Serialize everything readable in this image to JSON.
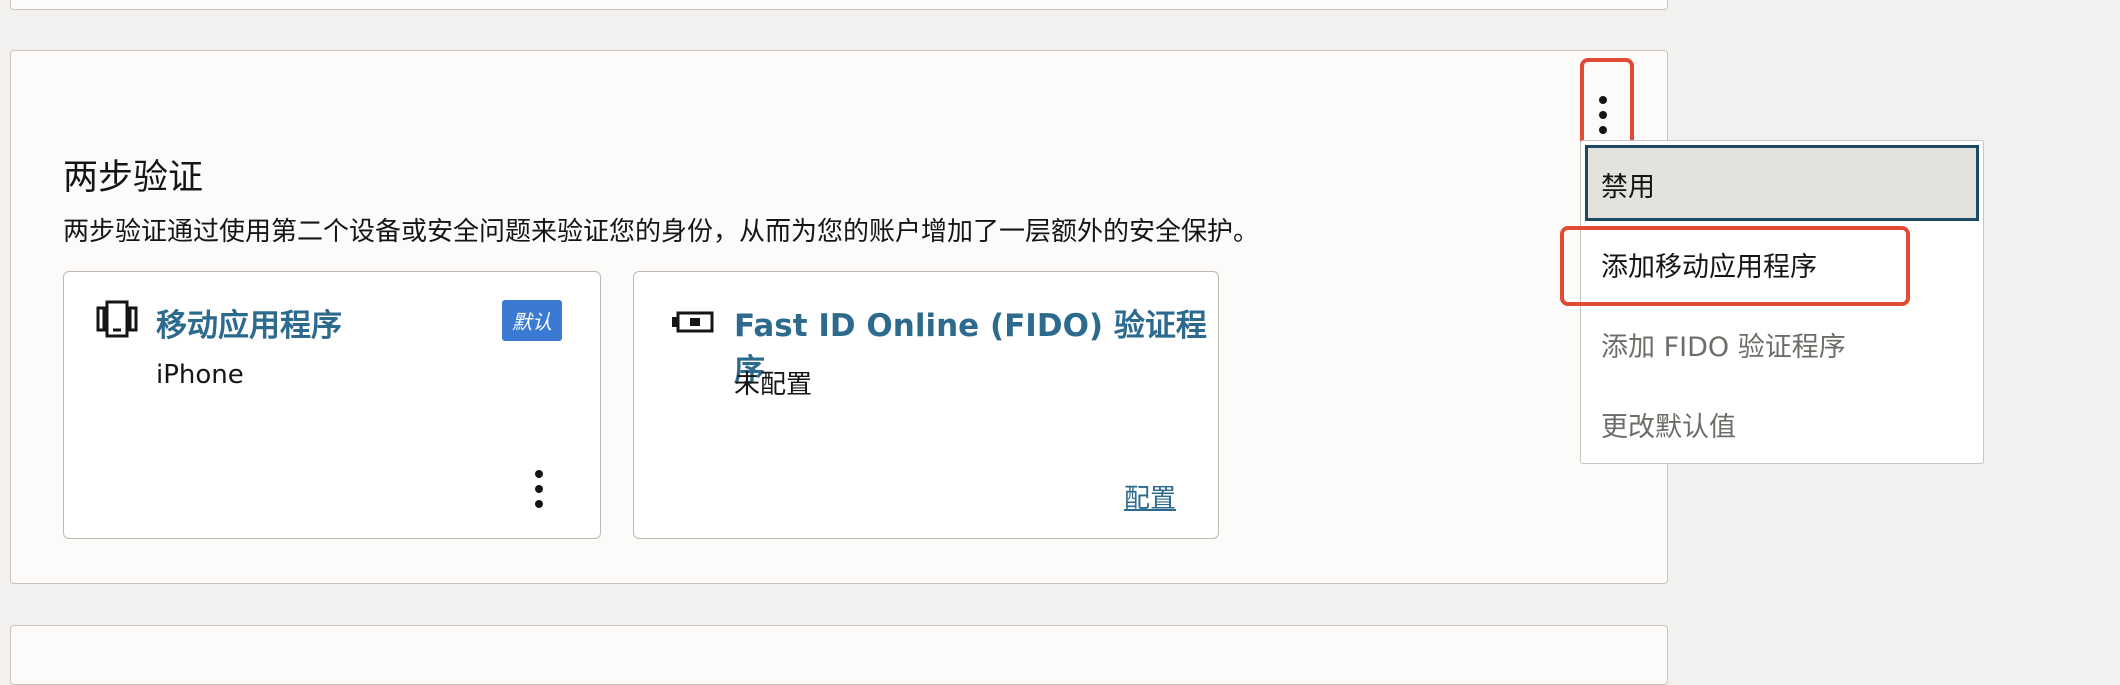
{
  "section": {
    "title": "两步验证",
    "description": "两步验证通过使用第二个设备或安全问题来验证您的身份，从而为您的账户增加了一层额外的安全保护。"
  },
  "cards": [
    {
      "name": "移动应用程序",
      "subtitle": "iPhone",
      "badge": "默认",
      "icon": "mobile-app-icon"
    },
    {
      "name": "Fast ID Online (FIDO) 验证程序",
      "subtitle": "未配置",
      "link": "配置",
      "icon": "security-key-icon"
    }
  ],
  "menu": {
    "items": [
      {
        "label": "禁用",
        "state": "focused"
      },
      {
        "label": "添加移动应用程序",
        "state": "highlighted"
      },
      {
        "label": "添加 FIDO 验证程序",
        "state": "disabled"
      },
      {
        "label": "更改默认值",
        "state": "disabled"
      }
    ]
  },
  "colors": {
    "link": "#2c6a8e",
    "badge": "#3b7ad4",
    "highlight": "#e14a34"
  }
}
